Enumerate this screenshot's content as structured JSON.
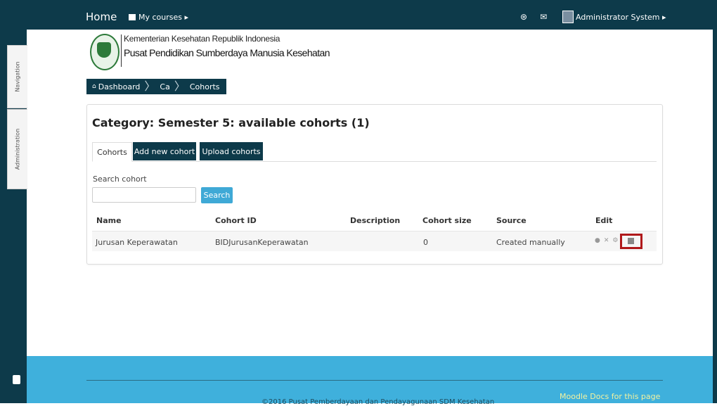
{
  "navbar": {
    "home": "Home",
    "my_courses": "My courses ▸",
    "user": "Administrator System ▸"
  },
  "dock": {
    "navigation": "Navigation",
    "administration": "Administration"
  },
  "logo": {
    "line1": "Kementerian Kesehatan Republik Indonesia",
    "line2": "Pusat Pendidikan Sumberdaya Manusia Kesehatan"
  },
  "breadcrumb": {
    "items": [
      "Dashboard",
      "Ca",
      "Cohorts"
    ]
  },
  "page": {
    "heading": "Category: Semester 5: available cohorts (1)"
  },
  "tabs": [
    "Cohorts",
    "Add new cohort",
    "Upload cohorts"
  ],
  "search": {
    "label": "Search cohort",
    "value": "",
    "placeholder": "",
    "button": "Search"
  },
  "table": {
    "headers": [
      "Name",
      "Cohort ID",
      "Description",
      "Cohort size",
      "Source",
      "Edit"
    ],
    "rows": [
      {
        "name": "Jurusan Keperawatan",
        "cohort_id": "BIDJurusanKeperawatan",
        "description": "",
        "size": "0",
        "source": "Created manually"
      }
    ]
  },
  "footer": {
    "docs": "Moodle Docs for this page",
    "copyright": "©2016 Pusat Pemberdayaan dan Pendayagunaan SDM Kesehatan"
  },
  "colors": {
    "nav_bg": "#0d3a4a",
    "footer_bg": "#3fb0dc",
    "accent_button": "#3fa9d6",
    "highlight": "#b0191b"
  }
}
